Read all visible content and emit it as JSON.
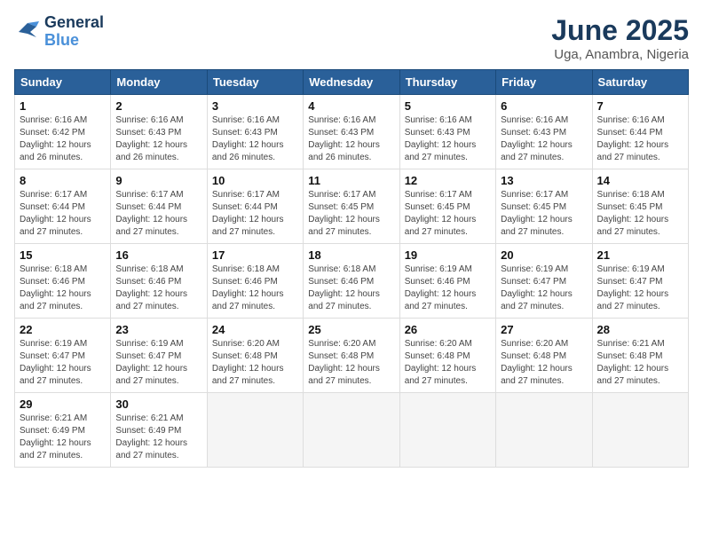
{
  "logo": {
    "line1": "General",
    "line2": "Blue"
  },
  "title": "June 2025",
  "subtitle": "Uga, Anambra, Nigeria",
  "headers": [
    "Sunday",
    "Monday",
    "Tuesday",
    "Wednesday",
    "Thursday",
    "Friday",
    "Saturday"
  ],
  "weeks": [
    [
      {
        "day": "1",
        "info": "Sunrise: 6:16 AM\nSunset: 6:42 PM\nDaylight: 12 hours\nand 26 minutes."
      },
      {
        "day": "2",
        "info": "Sunrise: 6:16 AM\nSunset: 6:43 PM\nDaylight: 12 hours\nand 26 minutes."
      },
      {
        "day": "3",
        "info": "Sunrise: 6:16 AM\nSunset: 6:43 PM\nDaylight: 12 hours\nand 26 minutes."
      },
      {
        "day": "4",
        "info": "Sunrise: 6:16 AM\nSunset: 6:43 PM\nDaylight: 12 hours\nand 26 minutes."
      },
      {
        "day": "5",
        "info": "Sunrise: 6:16 AM\nSunset: 6:43 PM\nDaylight: 12 hours\nand 27 minutes."
      },
      {
        "day": "6",
        "info": "Sunrise: 6:16 AM\nSunset: 6:43 PM\nDaylight: 12 hours\nand 27 minutes."
      },
      {
        "day": "7",
        "info": "Sunrise: 6:16 AM\nSunset: 6:44 PM\nDaylight: 12 hours\nand 27 minutes."
      }
    ],
    [
      {
        "day": "8",
        "info": "Sunrise: 6:17 AM\nSunset: 6:44 PM\nDaylight: 12 hours\nand 27 minutes."
      },
      {
        "day": "9",
        "info": "Sunrise: 6:17 AM\nSunset: 6:44 PM\nDaylight: 12 hours\nand 27 minutes."
      },
      {
        "day": "10",
        "info": "Sunrise: 6:17 AM\nSunset: 6:44 PM\nDaylight: 12 hours\nand 27 minutes."
      },
      {
        "day": "11",
        "info": "Sunrise: 6:17 AM\nSunset: 6:45 PM\nDaylight: 12 hours\nand 27 minutes."
      },
      {
        "day": "12",
        "info": "Sunrise: 6:17 AM\nSunset: 6:45 PM\nDaylight: 12 hours\nand 27 minutes."
      },
      {
        "day": "13",
        "info": "Sunrise: 6:17 AM\nSunset: 6:45 PM\nDaylight: 12 hours\nand 27 minutes."
      },
      {
        "day": "14",
        "info": "Sunrise: 6:18 AM\nSunset: 6:45 PM\nDaylight: 12 hours\nand 27 minutes."
      }
    ],
    [
      {
        "day": "15",
        "info": "Sunrise: 6:18 AM\nSunset: 6:46 PM\nDaylight: 12 hours\nand 27 minutes."
      },
      {
        "day": "16",
        "info": "Sunrise: 6:18 AM\nSunset: 6:46 PM\nDaylight: 12 hours\nand 27 minutes."
      },
      {
        "day": "17",
        "info": "Sunrise: 6:18 AM\nSunset: 6:46 PM\nDaylight: 12 hours\nand 27 minutes."
      },
      {
        "day": "18",
        "info": "Sunrise: 6:18 AM\nSunset: 6:46 PM\nDaylight: 12 hours\nand 27 minutes."
      },
      {
        "day": "19",
        "info": "Sunrise: 6:19 AM\nSunset: 6:46 PM\nDaylight: 12 hours\nand 27 minutes."
      },
      {
        "day": "20",
        "info": "Sunrise: 6:19 AM\nSunset: 6:47 PM\nDaylight: 12 hours\nand 27 minutes."
      },
      {
        "day": "21",
        "info": "Sunrise: 6:19 AM\nSunset: 6:47 PM\nDaylight: 12 hours\nand 27 minutes."
      }
    ],
    [
      {
        "day": "22",
        "info": "Sunrise: 6:19 AM\nSunset: 6:47 PM\nDaylight: 12 hours\nand 27 minutes."
      },
      {
        "day": "23",
        "info": "Sunrise: 6:19 AM\nSunset: 6:47 PM\nDaylight: 12 hours\nand 27 minutes."
      },
      {
        "day": "24",
        "info": "Sunrise: 6:20 AM\nSunset: 6:48 PM\nDaylight: 12 hours\nand 27 minutes."
      },
      {
        "day": "25",
        "info": "Sunrise: 6:20 AM\nSunset: 6:48 PM\nDaylight: 12 hours\nand 27 minutes."
      },
      {
        "day": "26",
        "info": "Sunrise: 6:20 AM\nSunset: 6:48 PM\nDaylight: 12 hours\nand 27 minutes."
      },
      {
        "day": "27",
        "info": "Sunrise: 6:20 AM\nSunset: 6:48 PM\nDaylight: 12 hours\nand 27 minutes."
      },
      {
        "day": "28",
        "info": "Sunrise: 6:21 AM\nSunset: 6:48 PM\nDaylight: 12 hours\nand 27 minutes."
      }
    ],
    [
      {
        "day": "29",
        "info": "Sunrise: 6:21 AM\nSunset: 6:49 PM\nDaylight: 12 hours\nand 27 minutes."
      },
      {
        "day": "30",
        "info": "Sunrise: 6:21 AM\nSunset: 6:49 PM\nDaylight: 12 hours\nand 27 minutes."
      },
      {
        "day": "",
        "info": ""
      },
      {
        "day": "",
        "info": ""
      },
      {
        "day": "",
        "info": ""
      },
      {
        "day": "",
        "info": ""
      },
      {
        "day": "",
        "info": ""
      }
    ]
  ]
}
